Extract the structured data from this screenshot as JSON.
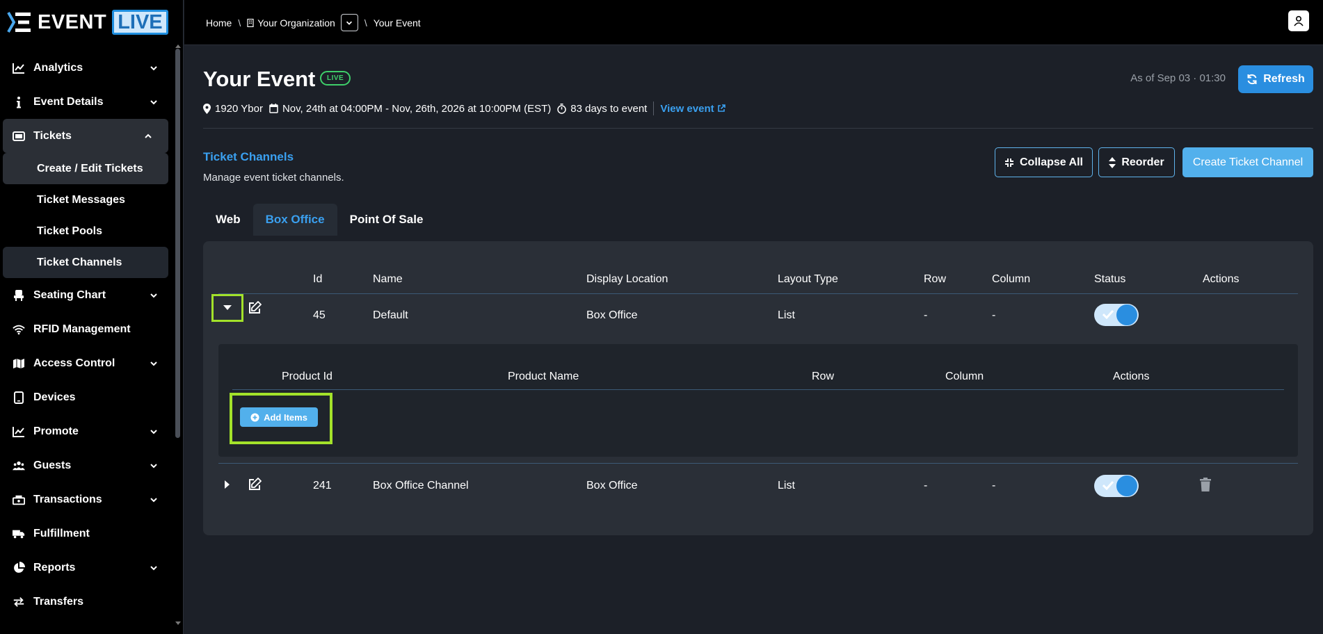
{
  "brand": {
    "logo_text": "EVENT",
    "logo_live": "LIVE"
  },
  "sidebar": {
    "items": [
      {
        "label": "Analytics",
        "icon": "chart-line-icon",
        "chevron": "down"
      },
      {
        "label": "Event Details",
        "icon": "info-icon",
        "chevron": "down"
      },
      {
        "label": "Tickets",
        "icon": "ticket-icon",
        "chevron": "up"
      },
      {
        "label": "Seating Chart",
        "icon": "chair-icon",
        "chevron": "down"
      },
      {
        "label": "RFID Management",
        "icon": "wifi-icon",
        "chevron": ""
      },
      {
        "label": "Access Control",
        "icon": "map-icon",
        "chevron": "down"
      },
      {
        "label": "Devices",
        "icon": "tablet-icon",
        "chevron": ""
      },
      {
        "label": "Promote",
        "icon": "chart-line-icon",
        "chevron": "down"
      },
      {
        "label": "Guests",
        "icon": "users-icon",
        "chevron": "down"
      },
      {
        "label": "Transactions",
        "icon": "cash-register-icon",
        "chevron": "down"
      },
      {
        "label": "Fulfillment",
        "icon": "truck-icon",
        "chevron": ""
      },
      {
        "label": "Reports",
        "icon": "pie-chart-icon",
        "chevron": "down"
      },
      {
        "label": "Transfers",
        "icon": "exchange-icon",
        "chevron": ""
      }
    ],
    "ticket_subitems": [
      {
        "label": "Create / Edit Tickets"
      },
      {
        "label": "Ticket Messages"
      },
      {
        "label": "Ticket Pools"
      },
      {
        "label": "Ticket Channels"
      }
    ]
  },
  "breadcrumb": {
    "home": "Home",
    "org": "Your Organization",
    "event": "Your Event"
  },
  "event": {
    "title": "Your Event",
    "badge": "LIVE",
    "venue": "1920 Ybor",
    "dates": "Nov, 24th at 04:00PM - Nov, 26th, 2026 at 10:00PM (EST)",
    "countdown": "83 days to event",
    "view_link": "View event",
    "as_of": "As of Sep 03 · 01:30",
    "refresh_label": "Refresh"
  },
  "section": {
    "title": "Ticket Channels",
    "subtitle": "Manage event ticket channels.",
    "collapse_label": "Collapse All",
    "reorder_label": "Reorder",
    "create_label": "Create Ticket Channel"
  },
  "tabs": [
    {
      "label": "Web",
      "active": false
    },
    {
      "label": "Box Office",
      "active": true
    },
    {
      "label": "Point Of Sale",
      "active": false
    }
  ],
  "table": {
    "headers": {
      "id": "Id",
      "name": "Name",
      "display": "Display Location",
      "layout": "Layout Type",
      "row": "Row",
      "column": "Column",
      "status": "Status",
      "actions": "Actions"
    },
    "rows": [
      {
        "id": "45",
        "name": "Default",
        "display": "Box Office",
        "layout": "List",
        "row": "-",
        "column": "-",
        "status": true,
        "expanded": true
      },
      {
        "id": "241",
        "name": "Box Office Channel",
        "display": "Box Office",
        "layout": "List",
        "row": "-",
        "column": "-",
        "status": true,
        "expanded": false
      }
    ]
  },
  "subtable": {
    "headers": {
      "product_id": "Product Id",
      "product_name": "Product Name",
      "row": "Row",
      "column": "Column",
      "actions": "Actions"
    },
    "add_label": "Add Items"
  },
  "colors": {
    "accent": "#2a8ee0",
    "link": "#3aa0f0",
    "live": "#3ecf6a",
    "highlight": "#a3e22a"
  }
}
